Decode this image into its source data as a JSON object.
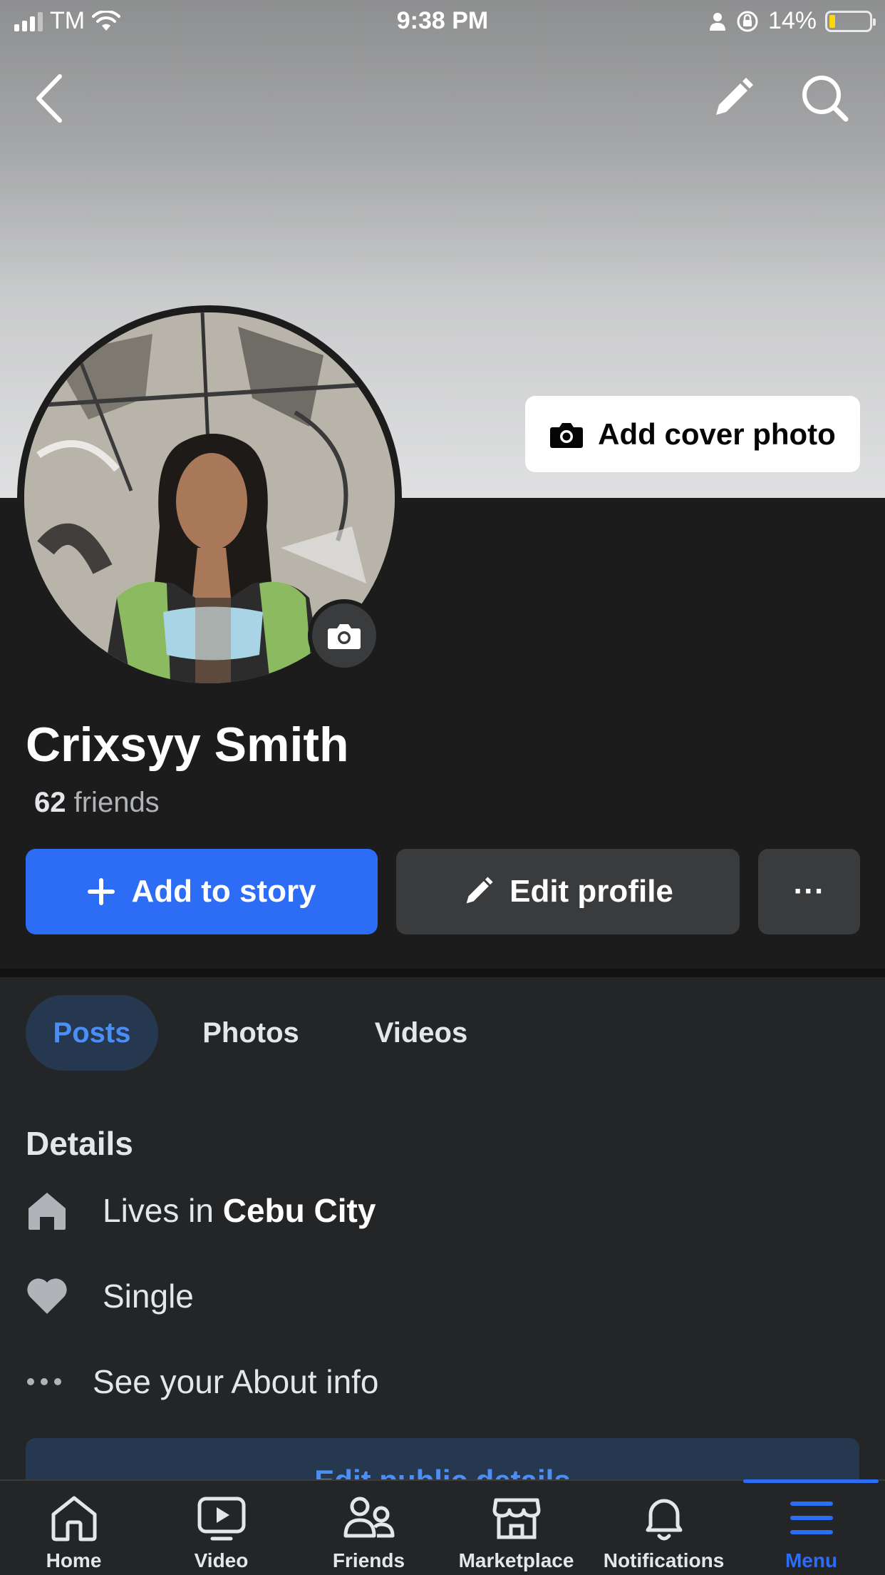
{
  "status_bar": {
    "carrier": "TM",
    "time": "9:38 PM",
    "battery": "14%",
    "battery_level": 0.14
  },
  "top_bar": {
    "back_icon": "chevron-left-icon",
    "edit_icon": "pencil-icon",
    "search_icon": "search-icon"
  },
  "cover": {
    "add_cover_label": "Add cover photo"
  },
  "profile": {
    "name": "Crixsyy Smith",
    "friends_count": "62",
    "friends_label": "friends"
  },
  "actions": {
    "add_story": "Add to story",
    "edit_profile": "Edit profile",
    "more": "···"
  },
  "tabs": [
    {
      "label": "Posts",
      "active": true
    },
    {
      "label": "Photos",
      "active": false
    },
    {
      "label": "Videos",
      "active": false
    }
  ],
  "details": {
    "title": "Details",
    "lives_prefix": "Lives in",
    "lives_city": "Cebu City",
    "relationship": "Single",
    "about": "See your About info",
    "edit_public": "Edit public details"
  },
  "nav": [
    {
      "label": "Home",
      "icon": "home-icon"
    },
    {
      "label": "Video",
      "icon": "video-icon"
    },
    {
      "label": "Friends",
      "icon": "friends-icon"
    },
    {
      "label": "Marketplace",
      "icon": "marketplace-icon"
    },
    {
      "label": "Notifications",
      "icon": "bell-icon"
    },
    {
      "label": "Menu",
      "icon": "menu-icon",
      "active": true
    }
  ],
  "colors": {
    "accent": "#2d6df6",
    "background": "#242526",
    "header_background": "#1c1c1d",
    "tab_active_bg": "#263850"
  }
}
